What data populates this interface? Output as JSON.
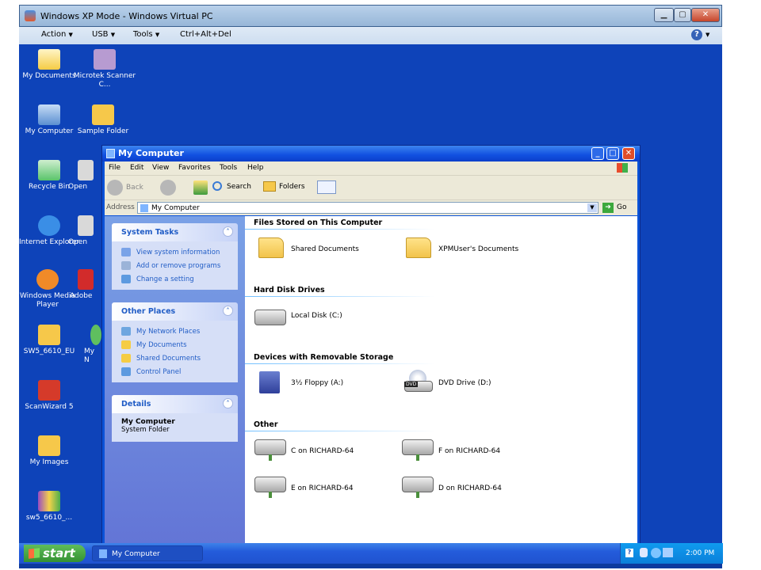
{
  "host": {
    "title": "Windows XP Mode - Windows Virtual PC",
    "menu": [
      {
        "label": "Action",
        "arrow": "▼"
      },
      {
        "label": "USB",
        "arrow": "▼"
      },
      {
        "label": "Tools",
        "arrow": "▼"
      },
      {
        "label": "Ctrl+Alt+Del",
        "arrow": ""
      }
    ],
    "help_glyph": "?",
    "help_arrow": "▼"
  },
  "desktop": {
    "icons": [
      {
        "label": "My Documents",
        "icon": "my-documents-icon",
        "color": "#f5cc44"
      },
      {
        "label": "Microtek Scanner C...",
        "icon": "scanner-icon",
        "color": "#b79bd1"
      },
      {
        "label": "My Computer",
        "icon": "my-computer-icon",
        "color": "#8fb7e6"
      },
      {
        "label": "Sample Folder",
        "icon": "folder-icon",
        "color": "#f6c84a"
      },
      {
        "label": "Recycle Bin",
        "icon": "recycle-bin-icon",
        "color": "#59c46a"
      },
      {
        "label": "Open",
        "icon": "shortcut-icon",
        "color": "#d9d9d9"
      },
      {
        "label": "Internet Explorer",
        "icon": "internet-explorer-icon",
        "color": "#3a8ee6"
      },
      {
        "label": "Open",
        "icon": "shortcut-icon",
        "color": "#d9d9d9"
      },
      {
        "label": "Windows Media Player",
        "icon": "media-player-icon",
        "color": "#f08a28"
      },
      {
        "label": "Adobe",
        "icon": "adobe-icon",
        "color": "#d22b2b"
      },
      {
        "label": "SW5_6610_EU",
        "icon": "folder-icon",
        "color": "#f6c84a"
      },
      {
        "label": "My N",
        "icon": "network-icon",
        "color": "#5fbf5f"
      },
      {
        "label": "ScanWizard 5",
        "icon": "scanwizard-icon",
        "color": "#d53a2a"
      },
      {
        "label": "My Images",
        "icon": "folder-icon",
        "color": "#f6c84a"
      },
      {
        "label": "sw5_6610_...",
        "icon": "archive-icon",
        "color": "#9a4cc2"
      }
    ]
  },
  "window": {
    "title": "My Computer",
    "menu": [
      "File",
      "Edit",
      "View",
      "Favorites",
      "Tools",
      "Help"
    ],
    "toolbar": {
      "back": "Back",
      "search": "Search",
      "folders": "Folders"
    },
    "address": {
      "label": "Address",
      "value": "My Computer",
      "go": "Go"
    },
    "panels": [
      {
        "title": "System Tasks",
        "items": [
          "View system information",
          "Add or remove programs",
          "Change a setting"
        ]
      },
      {
        "title": "Other Places",
        "items": [
          "My Network Places",
          "My Documents",
          "Shared Documents",
          "Control Panel"
        ]
      },
      {
        "title": "Details",
        "detail_name": "My Computer",
        "detail_type": "System Folder"
      }
    ],
    "sections": {
      "files": {
        "title": "Files Stored on This Computer",
        "items": [
          "Shared Documents",
          "XPMUser's Documents"
        ]
      },
      "hdd": {
        "title": "Hard Disk Drives",
        "items": [
          "Local Disk (C:)"
        ]
      },
      "removable": {
        "title": "Devices with Removable Storage",
        "items": [
          "3½ Floppy (A:)",
          "DVD Drive (D:)"
        ],
        "dvd_badge": "DVD"
      },
      "other": {
        "title": "Other",
        "items": [
          "C on RICHARD-64",
          "F on RICHARD-64",
          "E on RICHARD-64",
          "D on RICHARD-64"
        ]
      }
    }
  },
  "taskbar": {
    "start": "start",
    "task": "My Computer",
    "clock": "2:00 PM"
  }
}
